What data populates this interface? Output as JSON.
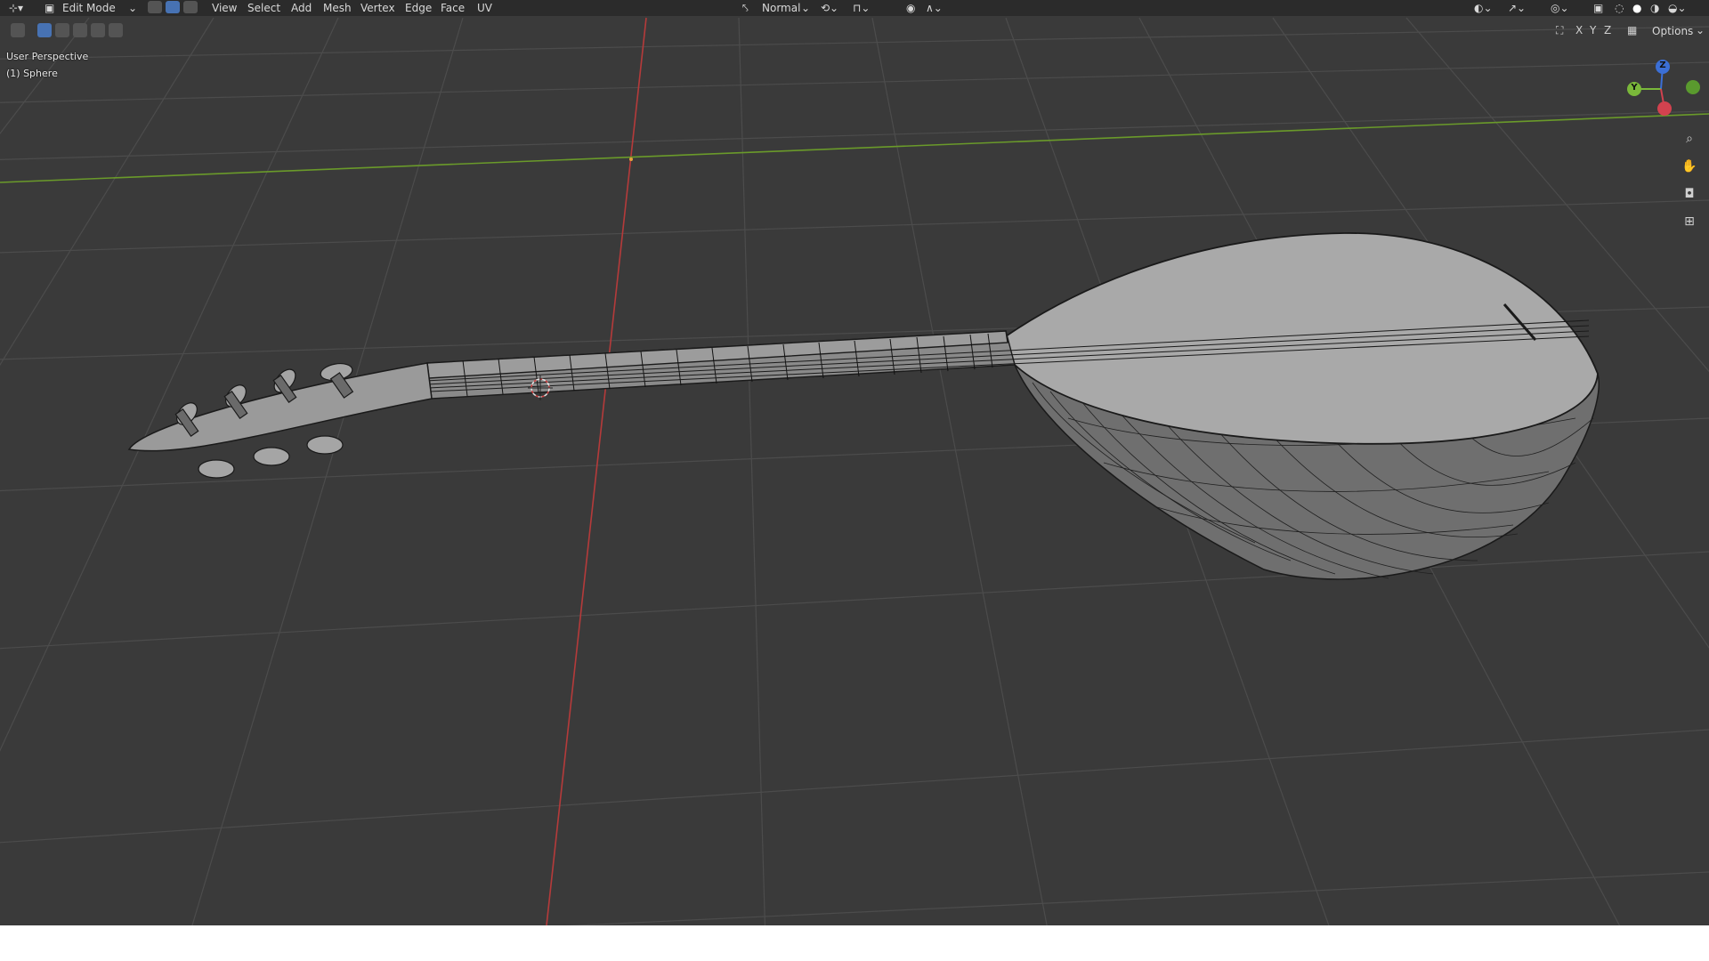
{
  "header": {
    "mode": "Edit Mode",
    "menus": [
      "View",
      "Select",
      "Add",
      "Mesh",
      "Vertex",
      "Edge",
      "Face",
      "UV"
    ],
    "orientation": "Normal"
  },
  "toolbar2": {
    "axes": [
      "X",
      "Y",
      "Z"
    ],
    "options_label": "Options"
  },
  "overlay": {
    "view_name": "User Perspective",
    "object_name": "(1) Sphere"
  },
  "gizmo": {
    "z_label": "Z",
    "y_label": "Y"
  },
  "colors": {
    "background": "#3a3a3a",
    "grid": "#505050",
    "x_axis": "#b53a3a",
    "y_axis": "#6a9a2a",
    "accent": "#4772b3",
    "mesh_face": "#a9a9a9",
    "mesh_wire": "#1a1a1a"
  },
  "icons": [
    "editor-type-icon",
    "mode-icon",
    "vertex-select-icon",
    "edge-select-icon",
    "face-select-icon",
    "transform-orientation-icon",
    "pivot-icon",
    "snap-icon",
    "proportional-icon",
    "falloff-icon",
    "visibility-icon",
    "gizmo-icon",
    "overlay-icon",
    "xray-icon",
    "wireframe-shading-icon",
    "solid-shading-icon",
    "material-shading-icon",
    "rendered-shading-icon",
    "zoom-icon",
    "pan-hand-icon",
    "camera-icon",
    "grid-view-icon",
    "cursor-3d-icon"
  ]
}
